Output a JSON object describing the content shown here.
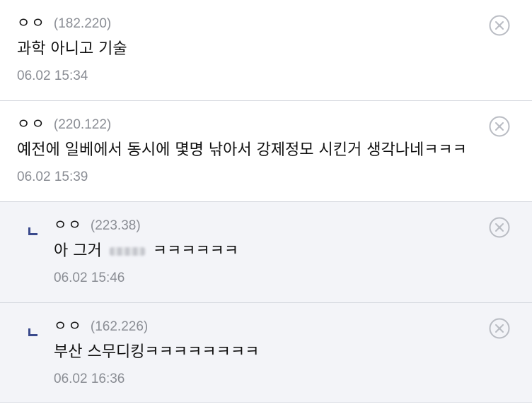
{
  "comments": [
    {
      "nick": "ㅇㅇ",
      "ip": "(182.220)",
      "text": "과학 아니고 기술",
      "date": "06.02 15:34",
      "reply": false
    },
    {
      "nick": "ㅇㅇ",
      "ip": "(220.122)",
      "text": "예전에 일베에서 동시에 몇명 낚아서 강제정모 시킨거 생각나네ㅋㅋㅋ",
      "date": "06.02 15:39",
      "reply": false
    },
    {
      "nick": "ㅇㅇ",
      "ip": "(223.38)",
      "text_before": "아 그거",
      "text_after": "ㅋㅋㅋㅋㅋㅋ",
      "date": "06.02 15:46",
      "reply": true
    },
    {
      "nick": "ㅇㅇ",
      "ip": "(162.226)",
      "text": "부산 스무디킹ㅋㅋㅋㅋㅋㅋㅋㅋ",
      "date": "06.02 16:36",
      "reply": true
    }
  ],
  "colors": {
    "reply_background": "#f3f4f8",
    "reply_marker": "#3a4a8c",
    "meta_text": "#8a8d94",
    "divider": "#d6d9e0"
  },
  "icons": {
    "delete": "close-circle-icon",
    "reply": "reply-arrow-icon"
  }
}
